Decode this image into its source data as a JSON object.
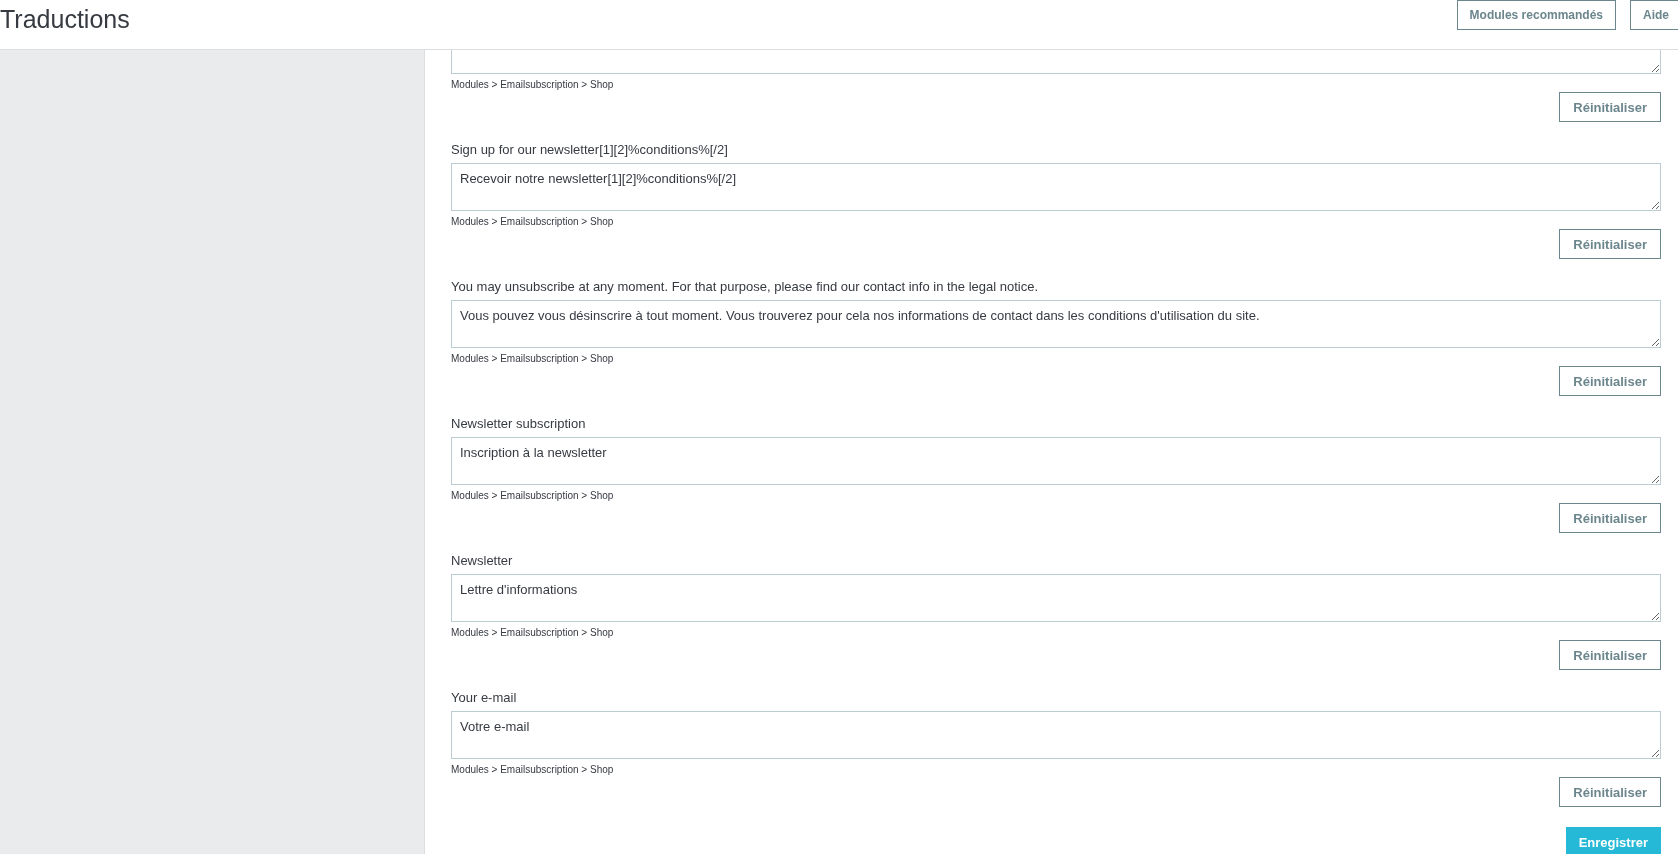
{
  "header": {
    "title": "Traductions",
    "buttons": [
      {
        "label": "Modules recommandés"
      },
      {
        "label": "Aide"
      }
    ]
  },
  "entries": [
    {
      "kind": "partial",
      "path": "Modules > Emailsubscription > Shop",
      "reset": "Réinitialiser"
    },
    {
      "kind": "full",
      "label": "Sign up for our newsletter[1][2]%conditions%[/2]",
      "value": "Recevoir notre newsletter[1][2]%conditions%[/2]",
      "path": "Modules > Emailsubscription > Shop",
      "reset": "Réinitialiser"
    },
    {
      "kind": "full",
      "label": "You may unsubscribe at any moment. For that purpose, please find our contact info in the legal notice.",
      "value": "Vous pouvez vous désinscrire à tout moment. Vous trouverez pour cela nos informations de contact dans les conditions d'utilisation du site.",
      "path": "Modules > Emailsubscription > Shop",
      "reset": "Réinitialiser"
    },
    {
      "kind": "full",
      "label": "Newsletter subscription",
      "value": "Inscription à la newsletter",
      "path": "Modules > Emailsubscription > Shop",
      "reset": "Réinitialiser"
    },
    {
      "kind": "full",
      "label": "Newsletter",
      "value": "Lettre d'informations",
      "path": "Modules > Emailsubscription > Shop",
      "reset": "Réinitialiser"
    },
    {
      "kind": "full",
      "label": "Your e-mail",
      "value": "Votre e-mail",
      "path": "Modules > Emailsubscription > Shop",
      "reset": "Réinitialiser"
    }
  ],
  "save_button": "Enregistrer"
}
